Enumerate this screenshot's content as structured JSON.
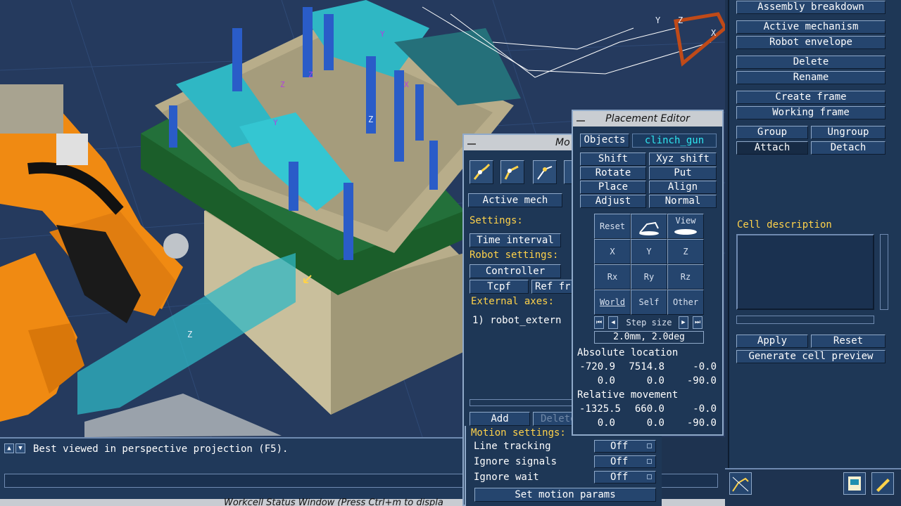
{
  "viewport": {
    "axis_labels": [
      "Z",
      "Y",
      "Z",
      "X",
      "Z",
      "Y",
      "Z",
      "Z",
      "X",
      "Y"
    ]
  },
  "right_panel": {
    "buttons": {
      "assembly_breakdown": "Assembly breakdown",
      "active_mechanism": "Active mechanism",
      "robot_envelope": "Robot envelope",
      "delete": "Delete",
      "rename": "Rename",
      "create_frame": "Create frame",
      "working_frame": "Working frame",
      "group": "Group",
      "ungroup": "Ungroup",
      "attach": "Attach",
      "detach": "Detach",
      "apply": "Apply",
      "reset": "Reset",
      "generate_cell_preview": "Generate cell preview"
    },
    "cell_description_label": "Cell description"
  },
  "status": {
    "message": "Best viewed in perspective projection (F5).",
    "window_title": "Workcell Status Window  (Press Ctrl+m to displa"
  },
  "motion_window": {
    "title": "Mo",
    "active_mech": "Active mech",
    "settings_label": "Settings:",
    "time_interval": "Time interval",
    "robot_settings_label": "Robot settings:",
    "controller": "Controller",
    "tcpf": "Tcpf",
    "ref_frame": "Ref fr",
    "external_axes_label": "External axes:",
    "external_axes": [
      "1) robot_extern"
    ],
    "add": "Add",
    "delete": "Delete",
    "motion_settings_label": "Motion settings:",
    "line_tracking": {
      "label": "Line tracking",
      "value": "Off"
    },
    "ignore_signals": {
      "label": "Ignore signals",
      "value": "Off"
    },
    "ignore_wait": {
      "label": "Ignore wait",
      "value": "Off"
    },
    "set_motion_params": "Set motion params"
  },
  "placement_editor": {
    "title": "Placement Editor",
    "objects_label": "Objects",
    "objects_value": "clinch_gun",
    "ops": {
      "shift": "Shift",
      "xyz_shift": "Xyz shift",
      "rotate": "Rotate",
      "put": "Put",
      "place": "Place",
      "align": "Align",
      "adjust": "Adjust",
      "normal": "Normal"
    },
    "grid": {
      "reset": "Reset",
      "view": "View",
      "x": "X",
      "y": "Y",
      "z": "Z",
      "rx": "Rx",
      "ry": "Ry",
      "rz": "Rz",
      "world": "World",
      "self": "Self",
      "other": "Other"
    },
    "step_size_label": "Step size",
    "step_size_value": "2.0mm, 2.0deg",
    "absolute_location_label": "Absolute location",
    "absolute_location": [
      [
        "-720.9",
        "7514.8",
        "-0.0"
      ],
      [
        "0.0",
        "0.0",
        "-90.0"
      ]
    ],
    "relative_movement_label": "Relative movement",
    "relative_movement": [
      [
        "-1325.5",
        "660.0",
        "-0.0"
      ],
      [
        "0.0",
        "0.0",
        "-90.0"
      ]
    ]
  },
  "colors": {
    "panel_bg": "#1e3756",
    "button_bg": "#25456e",
    "label_yellow": "#ffd24a",
    "accent_cyan": "#2fe6f0",
    "titlebar": "#c9cdd2",
    "robot_orange": "#f08a12",
    "fixture_green": "#1b5e2a",
    "part_cyan": "#2fb7c4",
    "clamp_blue": "#2a5cc8",
    "fixture_beige": "#b8ad8a"
  },
  "icons": [
    "robot-teach-icon",
    "robot-jog-icon",
    "robot-path-icon",
    "robot-view-icon",
    "view-camera-icon",
    "notebook-icon",
    "robot-tools-icon",
    "pen-icon"
  ]
}
